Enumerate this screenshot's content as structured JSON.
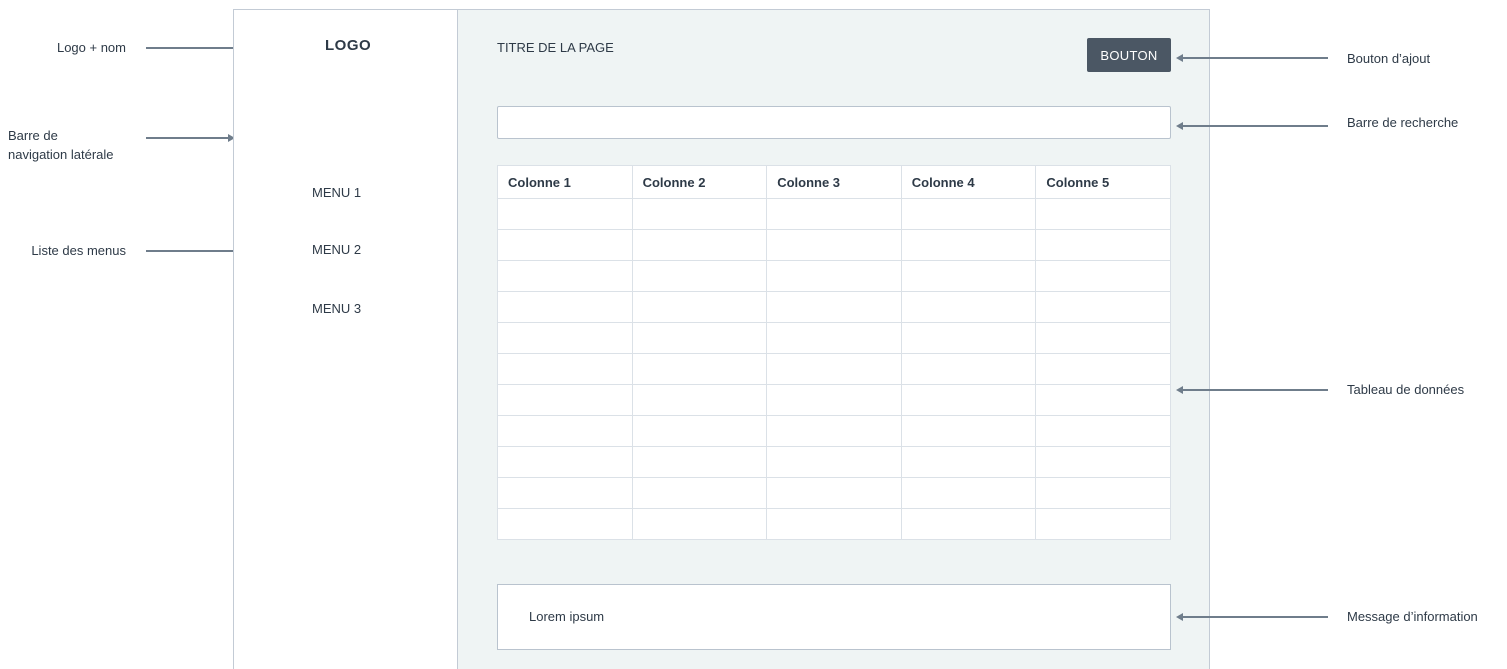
{
  "annotations": {
    "logo": "Logo + nom",
    "sidebar_line1": "Barre de",
    "sidebar_line2": "navigation latérale",
    "menu_list": "Liste des menus",
    "add_button": "Bouton d’ajout",
    "search_bar": "Barre de recherche",
    "data_table": "Tableau de données",
    "info_message": "Message d’information"
  },
  "sidebar": {
    "logo": "LOGO",
    "menu": [
      "MENU 1",
      "MENU 2",
      "MENU 3"
    ]
  },
  "main": {
    "title": "TITRE DE LA PAGE",
    "button_label": "BOUTON",
    "search_value": "",
    "table": {
      "columns": [
        "Colonne 1",
        "Colonne 2",
        "Colonne 3",
        "Colonne 4",
        "Colonne 5"
      ],
      "rows": [
        [
          "",
          "",
          "",
          "",
          ""
        ],
        [
          "",
          "",
          "",
          "",
          ""
        ],
        [
          "",
          "",
          "",
          "",
          ""
        ],
        [
          "",
          "",
          "",
          "",
          ""
        ],
        [
          "",
          "",
          "",
          "",
          ""
        ],
        [
          "",
          "",
          "",
          "",
          ""
        ],
        [
          "",
          "",
          "",
          "",
          ""
        ],
        [
          "",
          "",
          "",
          "",
          ""
        ],
        [
          "",
          "",
          "",
          "",
          ""
        ],
        [
          "",
          "",
          "",
          "",
          ""
        ],
        [
          "",
          "",
          "",
          "",
          ""
        ]
      ]
    },
    "info_text": "Lorem ipsum"
  },
  "colors": {
    "button_bg": "#4b5764",
    "main_bg": "#eff4f4",
    "arrow": "#6f7d8b"
  }
}
